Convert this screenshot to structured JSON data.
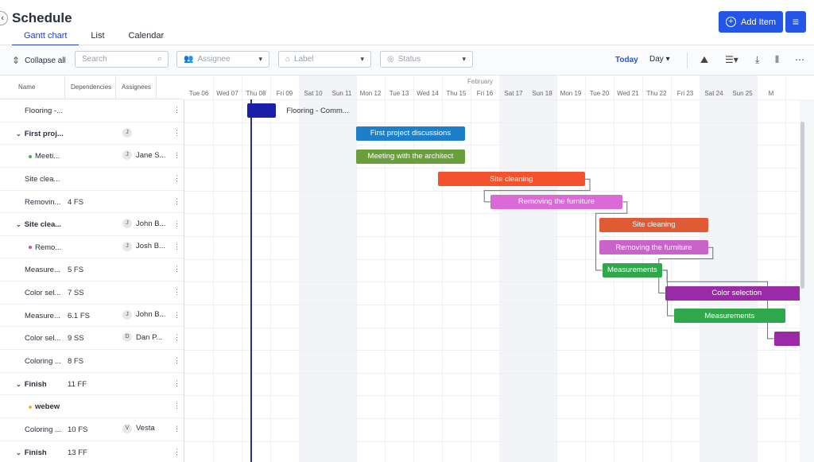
{
  "header": {
    "back_icon": "chevron-left-icon",
    "title": "Schedule",
    "tabs": [
      {
        "label": "Gantt chart",
        "active": true
      },
      {
        "label": "List",
        "active": false
      },
      {
        "label": "Calendar",
        "active": false
      }
    ],
    "add_item_label": "Add Item"
  },
  "toolbar": {
    "collapse_label": "Collapse all",
    "search_placeholder": "Search",
    "assignee_placeholder": "Assignee",
    "label_placeholder": "Label",
    "status_placeholder": "Status",
    "today_label": "Today",
    "view_value": "Day"
  },
  "grid": {
    "col_name": "Name",
    "col_dependencies": "Dependencies",
    "col_assignees": "Assignees",
    "rows": [
      {
        "name": "Flooring -...",
        "dep": "",
        "initial": "",
        "assignee": "",
        "bold": false,
        "chevron": false,
        "dot": "",
        "indent": 1
      },
      {
        "name": "First proj...",
        "dep": "",
        "initial": "J",
        "assignee": "",
        "bold": true,
        "chevron": true,
        "dot": "",
        "indent": 0
      },
      {
        "name": "Meeti...",
        "dep": "",
        "initial": "J",
        "assignee": "Jane S...",
        "bold": false,
        "chevron": false,
        "dot": "#4caf50",
        "indent": 2
      },
      {
        "name": "Site clea...",
        "dep": "",
        "initial": "",
        "assignee": "",
        "bold": false,
        "chevron": false,
        "dot": "",
        "indent": 1
      },
      {
        "name": "Removin...",
        "dep": "4 FS",
        "initial": "",
        "assignee": "",
        "bold": false,
        "chevron": false,
        "dot": "",
        "indent": 1
      },
      {
        "name": "Site clea...",
        "dep": "",
        "initial": "J",
        "assignee": "John B...",
        "bold": true,
        "chevron": true,
        "dot": "",
        "indent": 0
      },
      {
        "name": "Remo...",
        "dep": "",
        "initial": "J",
        "assignee": "Josh B...",
        "bold": false,
        "chevron": false,
        "dot": "#c04fc9",
        "indent": 2
      },
      {
        "name": "Measure...",
        "dep": "5 FS",
        "initial": "",
        "assignee": "",
        "bold": false,
        "chevron": false,
        "dot": "",
        "indent": 1
      },
      {
        "name": "Color sel...",
        "dep": "7 SS",
        "initial": "",
        "assignee": "",
        "bold": false,
        "chevron": false,
        "dot": "",
        "indent": 1
      },
      {
        "name": "Measure...",
        "dep": "6.1 FS",
        "initial": "J",
        "assignee": "John B...",
        "bold": false,
        "chevron": false,
        "dot": "",
        "indent": 1
      },
      {
        "name": "Color sel...",
        "dep": "9 SS",
        "initial": "D",
        "assignee": "Dan P...",
        "bold": false,
        "chevron": false,
        "dot": "",
        "indent": 1
      },
      {
        "name": "Coloring ...",
        "dep": "8 FS",
        "initial": "",
        "assignee": "",
        "bold": false,
        "chevron": false,
        "dot": "",
        "indent": 1
      },
      {
        "name": "Finish",
        "dep": "11 FF",
        "initial": "",
        "assignee": "",
        "bold": true,
        "chevron": true,
        "dot": "",
        "indent": 0
      },
      {
        "name": "webew",
        "dep": "",
        "initial": "",
        "assignee": "",
        "bold": true,
        "chevron": false,
        "dot": "#f0b429",
        "indent": 2
      },
      {
        "name": "Coloring ...",
        "dep": "10 FS",
        "initial": "V",
        "assignee": "Vesta",
        "bold": false,
        "chevron": false,
        "dot": "",
        "indent": 1
      },
      {
        "name": "Finish",
        "dep": "13 FF",
        "initial": "",
        "assignee": "",
        "bold": true,
        "chevron": true,
        "dot": "",
        "indent": 0
      }
    ]
  },
  "timeline": {
    "month": "February",
    "days": [
      "Tue 06",
      "Wed 07",
      "Thu 08",
      "Fri 09",
      "Sat 10",
      "Sun 11",
      "Mon 12",
      "Tue 13",
      "Wed 14",
      "Thu 15",
      "Fri 16",
      "Sat 17",
      "Sun 18",
      "Mon 19",
      "Tue 20",
      "Wed 21",
      "Thu 22",
      "Fri 23",
      "Sat 24",
      "Sun 25",
      "M"
    ],
    "bars": [
      {
        "row": 0,
        "start": 2.2,
        "end": 3.2,
        "color": "#1a1fa8",
        "label": "",
        "outside_label": "Flooring - Comm..."
      },
      {
        "row": 1,
        "start": 6,
        "end": 9.8,
        "color": "#1e7fc9",
        "label": "First project discussions"
      },
      {
        "row": 2,
        "start": 6,
        "end": 9.8,
        "color": "#6a9f3c",
        "label": "Meeting with the architect"
      },
      {
        "row": 3,
        "start": 8.85,
        "end": 14,
        "color": "#f4522d",
        "label": "Site cleaning"
      },
      {
        "row": 4,
        "start": 10.7,
        "end": 15.3,
        "color": "#d96ad8",
        "label": "Removing the furniture"
      },
      {
        "row": 5,
        "start": 14.5,
        "end": 18.3,
        "color": "#e05a36",
        "label": "Site cleaning"
      },
      {
        "row": 6,
        "start": 14.5,
        "end": 18.3,
        "color": "#c864c9",
        "label": "Removing the furniture"
      },
      {
        "row": 7,
        "start": 14.6,
        "end": 16.7,
        "color": "#2ea84a",
        "label": "Measurements"
      },
      {
        "row": 8,
        "start": 16.8,
        "end": 21.8,
        "color": "#9b2aa8",
        "label": "Color selection"
      },
      {
        "row": 9,
        "start": 17.1,
        "end": 21.0,
        "color": "#2ea84a",
        "label": "Measurements"
      },
      {
        "row": 10,
        "start": 20.6,
        "end": 21.8,
        "color": "#9b2aa8",
        "label": ""
      }
    ]
  }
}
